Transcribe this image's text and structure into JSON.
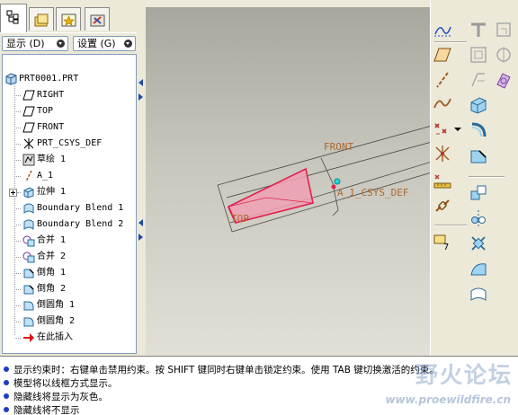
{
  "model_tree": {
    "tabs": [
      {
        "icon": "model-tree-icon",
        "active": true
      },
      {
        "icon": "folder-browser-icon",
        "active": false
      },
      {
        "icon": "favorites-icon",
        "active": false
      },
      {
        "icon": "connections-icon",
        "active": false
      }
    ],
    "show_menu": "显示 (D)",
    "settings_menu": "设置 (G)",
    "items": [
      {
        "label": "PRT0001.PRT",
        "icon": "part-icon"
      },
      {
        "label": "RIGHT",
        "icon": "datum-plane-icon"
      },
      {
        "label": "TOP",
        "icon": "datum-plane-icon"
      },
      {
        "label": "FRONT",
        "icon": "datum-plane-icon"
      },
      {
        "label": "PRT_CSYS_DEF",
        "icon": "csys-icon"
      },
      {
        "label": "草绘 1",
        "icon": "sketch-icon"
      },
      {
        "label": "A_1",
        "icon": "axis-icon"
      },
      {
        "label": "拉伸 1",
        "icon": "extrude-icon"
      },
      {
        "label": "Boundary Blend 1",
        "icon": "boundary-blend-icon"
      },
      {
        "label": "Boundary Blend 2",
        "icon": "boundary-blend-icon"
      },
      {
        "label": "合并 1",
        "icon": "merge-icon"
      },
      {
        "label": "合并 2",
        "icon": "merge-icon"
      },
      {
        "label": "倒角 1",
        "icon": "chamfer-icon"
      },
      {
        "label": "倒角 2",
        "icon": "chamfer-icon"
      },
      {
        "label": "倒圆角 1",
        "icon": "round-icon"
      },
      {
        "label": "倒圆角 2",
        "icon": "round-icon"
      },
      {
        "label": "在此插入",
        "icon": "insert-here-arrow-icon"
      }
    ]
  },
  "graphics": {
    "labels": {
      "front": "FRONT",
      "top": "TOP",
      "csys": "A_1_CSYS_DEF"
    },
    "colors": {
      "highlight": "#e0204a",
      "fill": "#f0a0b4",
      "datum": "#a86a30"
    }
  },
  "right_toolbar": {
    "icons": [
      "datum-curve-sketch-icon",
      "datum-plane-icon",
      "datum-curve-icon",
      "datum-point-icon",
      "datum-csys-icon",
      "analysis-icon",
      "extrude-tool-icon",
      "revolve-tool-icon",
      "sweep-icon",
      "blend-icon",
      "shell-icon",
      "rib-icon",
      "draft-icon",
      "round-tool-icon",
      "chamfer-tool-icon",
      "hole-icon",
      "pattern-icon",
      "mirror-icon",
      "merge-tool-icon",
      "trim-icon",
      "offset-icon",
      "thicken-icon",
      "solidify-icon"
    ]
  },
  "messages": [
    {
      "text": "显示约束时：右键单击禁用约束。按 SHIFT 键同时右键单击锁定约束。使用 TAB 键切换激活的约束。"
    },
    {
      "text": "模型将以线框方式显示。"
    },
    {
      "text": "隐藏线将显示为灰色。"
    },
    {
      "text": "隐藏线将不显示"
    }
  ],
  "watermark": {
    "title": "野火论坛",
    "url": "www.proewildfire.cn"
  }
}
